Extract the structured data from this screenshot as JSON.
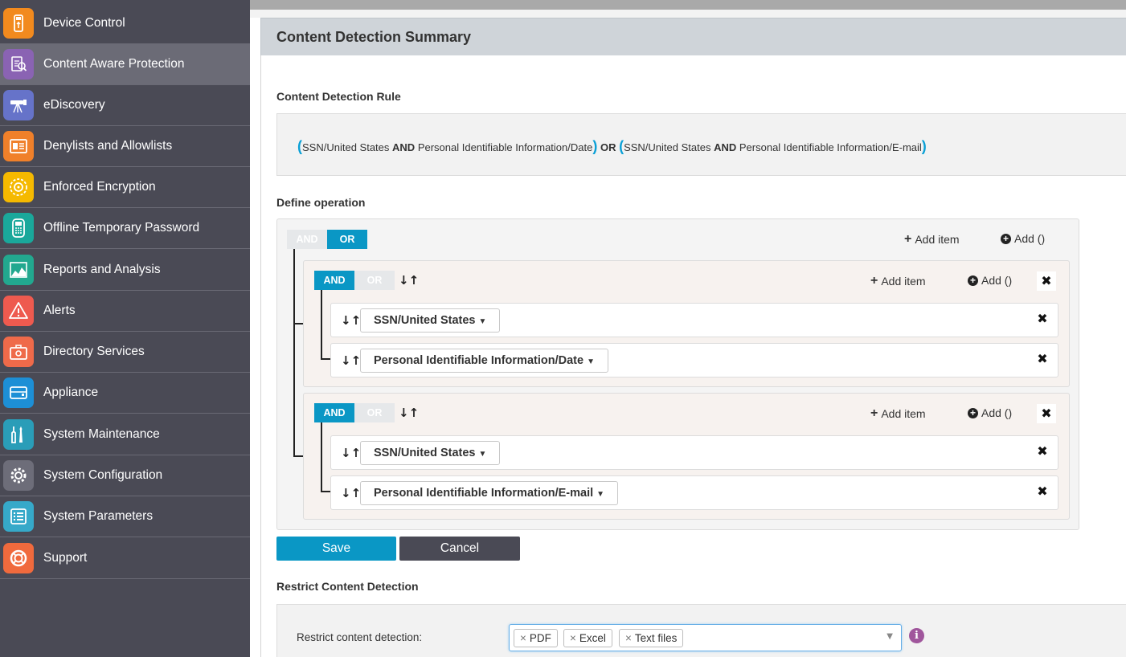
{
  "sidebar": {
    "items": [
      {
        "label": "Device Control",
        "icon": "usb-icon",
        "color": "#f28a1e"
      },
      {
        "label": "Content Aware Protection",
        "icon": "document-search-icon",
        "color": "#8a63b3"
      },
      {
        "label": "eDiscovery",
        "icon": "telescope-icon",
        "color": "#6673c9"
      },
      {
        "label": "Denylists and Allowlists",
        "icon": "list-card-icon",
        "color": "#f0802a"
      },
      {
        "label": "Enforced Encryption",
        "icon": "lock-dial-icon",
        "color": "#f5b900"
      },
      {
        "label": "Offline Temporary Password",
        "icon": "keypad-icon",
        "color": "#1aa89b"
      },
      {
        "label": "Reports and Analysis",
        "icon": "chart-icon",
        "color": "#22a88f"
      },
      {
        "label": "Alerts",
        "icon": "warning-icon",
        "color": "#ee5a4f"
      },
      {
        "label": "Directory Services",
        "icon": "briefcase-icon",
        "color": "#ef6a4a"
      },
      {
        "label": "Appliance",
        "icon": "appliance-icon",
        "color": "#1d8fd6"
      },
      {
        "label": "System Maintenance",
        "icon": "tools-icon",
        "color": "#2a9db8"
      },
      {
        "label": "System Configuration",
        "icon": "gear-icon",
        "color": "#6d6d79"
      },
      {
        "label": "System Parameters",
        "icon": "parameters-list-icon",
        "color": "#36a9c9"
      },
      {
        "label": "Support",
        "icon": "lifebuoy-icon",
        "color": "#f06a3d"
      }
    ],
    "active_index": 1
  },
  "main": {
    "title": "Content Detection Summary",
    "rule_section_label": "Content Detection Rule",
    "rule": {
      "g1_a": "SSN/United States",
      "g1_op": "AND",
      "g1_b": "Personal Identifiable Information/Date",
      "between_op": "OR",
      "g2_a": "SSN/United States",
      "g2_op": "AND",
      "g2_b": "Personal Identifiable Information/E-mail",
      "open": "(",
      "close": ")"
    },
    "define_label": "Define operation",
    "operation": {
      "and_label": "AND",
      "or_label": "OR",
      "selected": "OR",
      "add_item_label": "Add item",
      "add_paren_label": "Add ()",
      "groups": [
        {
          "selected": "AND",
          "items": [
            "SSN/United States",
            "Personal Identifiable Information/Date"
          ]
        },
        {
          "selected": "AND",
          "items": [
            "SSN/United States",
            "Personal Identifiable Information/E-mail"
          ]
        }
      ]
    },
    "save_label": "Save",
    "cancel_label": "Cancel",
    "restrict_section_label": "Restrict Content Detection",
    "restrict": {
      "label": "Restrict content detection:",
      "tags": [
        "PDF",
        "Excel",
        "Text files"
      ],
      "info_symbol": "i"
    }
  },
  "colors": {
    "accent": "#0a97c5",
    "sidebar_bg": "#4a4a55",
    "cancel_bg": "#4a4a55"
  }
}
